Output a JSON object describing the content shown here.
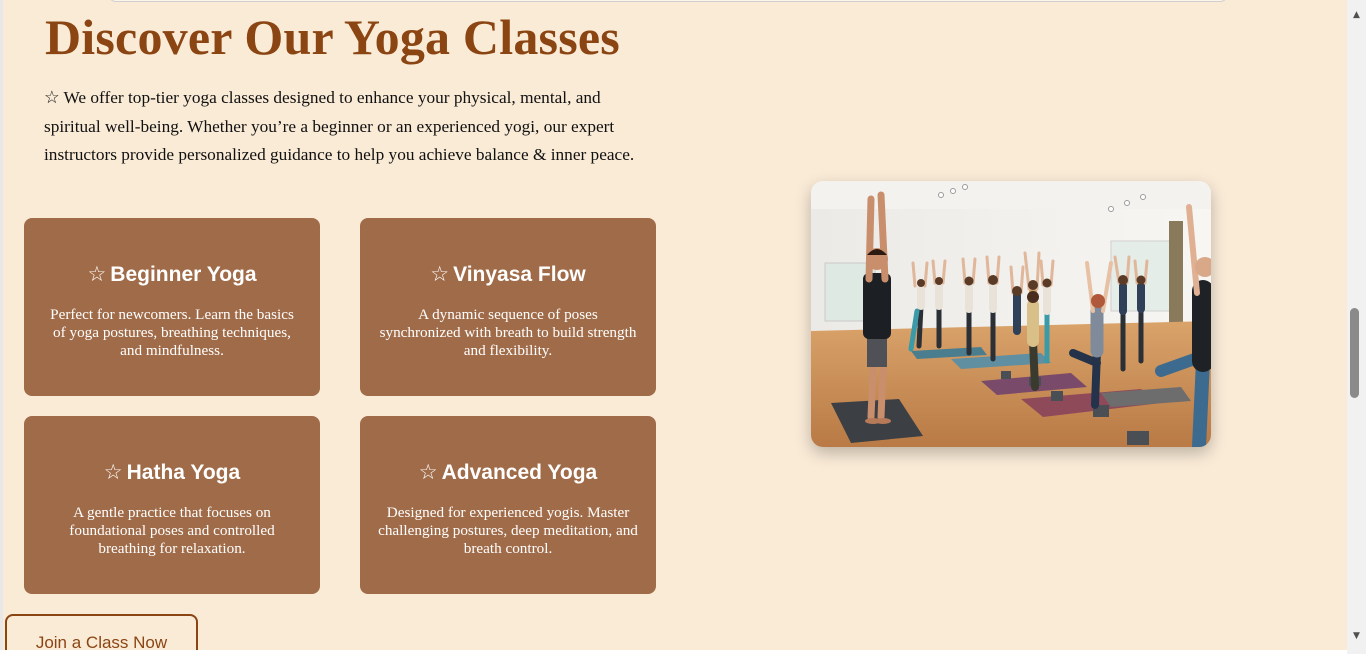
{
  "section": {
    "title": "Discover Our Yoga Classes",
    "intro": "☆ We offer top-tier yoga classes designed to enhance your physical, mental, and spiritual well-being. Whether you’re a beginner or an experienced yogi, our expert instructors provide personalized guidance to help you achieve balance & inner peace."
  },
  "cards": [
    {
      "star": "☆",
      "title": "Beginner Yoga",
      "desc": "Perfect for newcomers. Learn the basics of yoga postures, breathing techniques, and mindfulness."
    },
    {
      "star": "☆",
      "title": "Vinyasa Flow",
      "desc": "A dynamic sequence of poses synchronized with breath to build strength and flexibility."
    },
    {
      "star": "☆",
      "title": "Hatha Yoga",
      "desc": "A gentle practice that focuses on foundational poses and controlled breathing for relaxation."
    },
    {
      "star": "☆",
      "title": "Advanced Yoga",
      "desc": "Designed for experienced yogis. Master challenging postures, deep meditation, and breath control."
    }
  ],
  "cta": {
    "label": "Join a Class Now"
  },
  "colors": {
    "page_bg": "#faebd7",
    "accent": "#8b4513",
    "card_bg": "#a06b48"
  },
  "scrollbar": {
    "up_icon": "▲",
    "down_icon": "▼"
  }
}
